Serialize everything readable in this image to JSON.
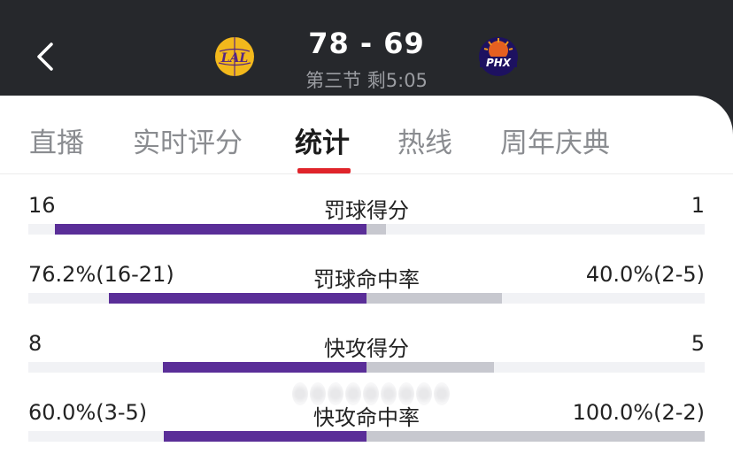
{
  "header": {
    "score": "78 - 69",
    "period": "第三节 剩5:05",
    "home_team_logo_text": "LAL",
    "away_team_logo_text": "PHX",
    "home_color": "#f2b81c",
    "home_secondary": "#552583",
    "away_color": "#1d1160",
    "away_accent": "#e56020"
  },
  "tabs": [
    {
      "label": "直播"
    },
    {
      "label": "实时评分"
    },
    {
      "label": "统计",
      "active": true
    },
    {
      "label": "热线"
    },
    {
      "label": "周年庆典"
    }
  ],
  "colors": {
    "left_bar": "#5a2e98",
    "right_bar": "#c7c8cf",
    "track": "#f1f2f5",
    "tab_indicator": "#e0242a"
  },
  "stats": [
    {
      "label": "罚球得分",
      "left": "16",
      "right": "1",
      "left_value": 16,
      "right_value": 1
    },
    {
      "label": "罚球命中率",
      "left": "76.2%(16-21)",
      "right": "40.0%(2-5)",
      "left_value": 76.2,
      "right_value": 40.0
    },
    {
      "label": "快攻得分",
      "left": "8",
      "right": "5",
      "left_value": 8,
      "right_value": 5
    },
    {
      "label": "快攻命中率",
      "left": "60.0%(3-5)",
      "right": "100.0%(2-2)",
      "left_value": 60.0,
      "right_value": 100.0
    }
  ]
}
